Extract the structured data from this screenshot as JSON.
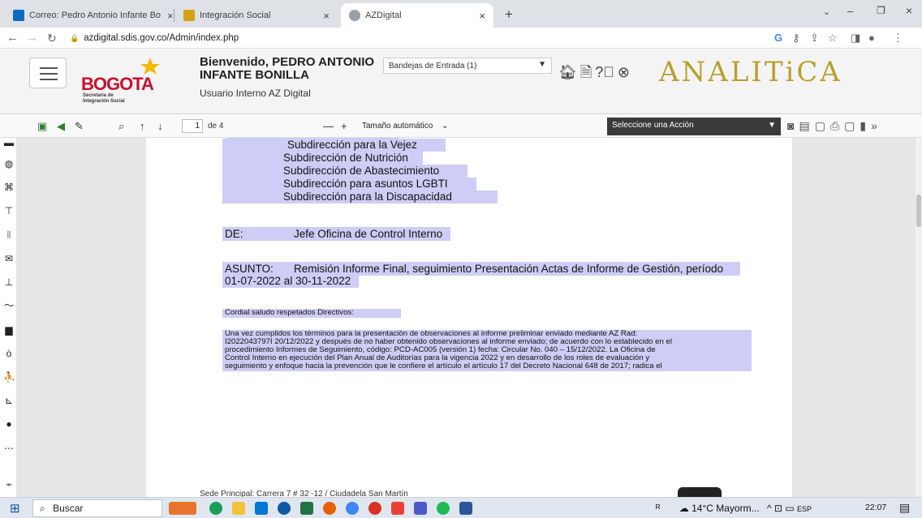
{
  "browser": {
    "tabs": [
      {
        "title": "Correo: Pedro Antonio Infante Bo",
        "color": "#0f6cbd"
      },
      {
        "title": "Integración Social",
        "color": "#d4a017"
      },
      {
        "title": "AZDigital",
        "color": "#5f6368"
      }
    ],
    "new_tab_symbol": "+",
    "url": "azdigital.sdis.gov.co/Admin/index.php"
  },
  "header": {
    "logo_word": "BOGOTA",
    "logo_sub1": "Secretaría de",
    "logo_sub2": "Integración Social",
    "welcome_line1": "Bienvenido, PEDRO ANTONIO",
    "welcome_line2": "INFANTE BONILLA",
    "user_type": "Usuario Interno AZ Digital",
    "inbox_select": "Bandejas de Entrada (1)",
    "brand": "ANALITiCA"
  },
  "pdf_toolbar": {
    "page_value": "1",
    "page_total": "de 4",
    "zoom_select": "Tamaño automático",
    "action_select": "Seleccione una Acción"
  },
  "document": {
    "dest_lines": [
      "Subdirección para la Vejez",
      "Subdirección de Nutrición",
      "Subdirección de Abastecimiento",
      "Subdirección para asuntos LGBTI",
      "Subdirección para la Discapacidad"
    ],
    "de_label": "DE:",
    "de_value": "Jefe Oficina de Control Interno",
    "asunto_label": "ASUNTO:",
    "asunto_line1": "Remisión Informe Final, seguimiento Presentación Actas de Informe de Gestión, período",
    "asunto_line2": "01-07-2022 al 30-11-2022",
    "greeting": "Cordial saludo respetados Directivos:",
    "body_lines": [
      "Una vez cumplidos los términos para la presentación de observaciones al informe preliminar enviado mediante AZ Rad:",
      "I2022043797I 20/12/2022 y después de no haber obtenido observaciones al informe enviado; de acuerdo con lo establecido en el",
      "procedimiento Informes de Seguimiento, código: PCD-AC005 (versión 1) fecha: Circular No. 040 – 15/12/2022. La Oficina de",
      "Control Interno en ejecución del Plan Anual de Auditorías para la vigencia 2022 y en desarrollo de los roles de evaluación y",
      "seguimiento y enfoque hacia la prevención que le confiere el artículo el artículo 17 del Decreto Nacional 648 de 2017; radica el"
    ],
    "footer": "Sede Principal: Carrera 7 # 32 -12 / Ciudadela San Martín"
  },
  "taskbar": {
    "search_text": "Buscar",
    "weather": "14°C Mayorm...",
    "lang": "ESP",
    "time": "22:07"
  }
}
